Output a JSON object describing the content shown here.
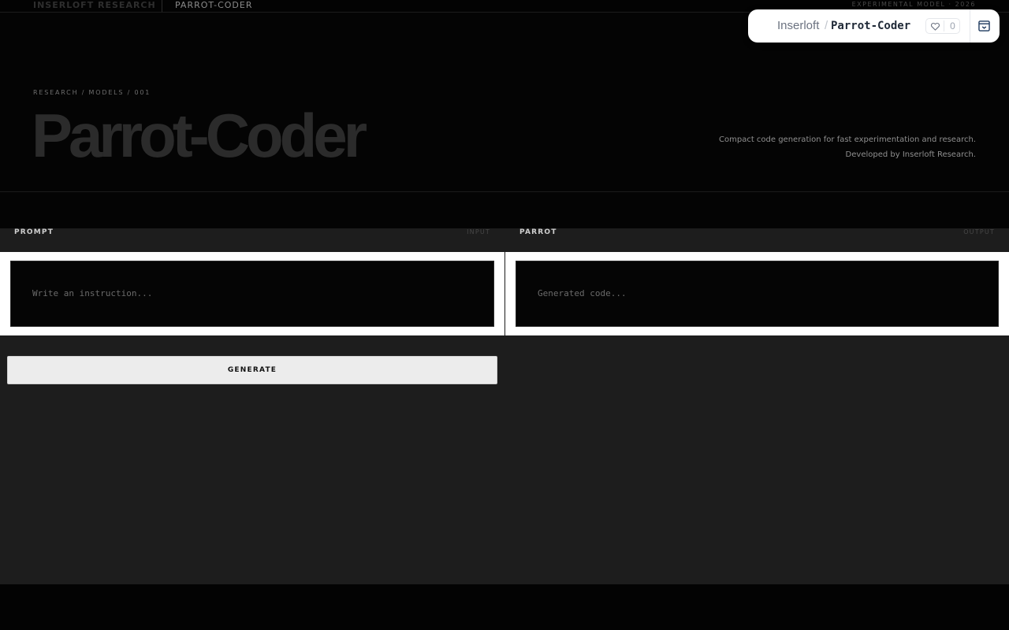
{
  "topbar": {
    "brand": "INSERLOFT RESEARCH",
    "model": "PARROT-CODER",
    "experimental": "EXPERIMENTAL MODEL · 2026"
  },
  "hub": {
    "org": "Inserloft",
    "separator": "/",
    "repo": "Parrot-Coder",
    "like_count": "0",
    "icons": [
      "heart-icon",
      "panel-toggle-icon"
    ]
  },
  "hero": {
    "breadcrumb": "RESEARCH / MODELS / 001",
    "title": "Parrot-Coder",
    "description_line1": "Compact code generation for fast experimentation and research.",
    "description_line2": "Developed by Inserloft Research."
  },
  "prompt_pane": {
    "title": "PROMPT",
    "tag": "INPUT",
    "placeholder": "Write an instruction...",
    "value": ""
  },
  "output_pane": {
    "title": "PARROT",
    "tag": "OUTPUT",
    "placeholder": "Generated code...",
    "value": ""
  },
  "actions": {
    "generate_label": "GENERATE"
  },
  "colors": {
    "background": "#030303",
    "workspace": "#1d1d1d",
    "panel": "#ffffff",
    "button": "#ececec"
  }
}
